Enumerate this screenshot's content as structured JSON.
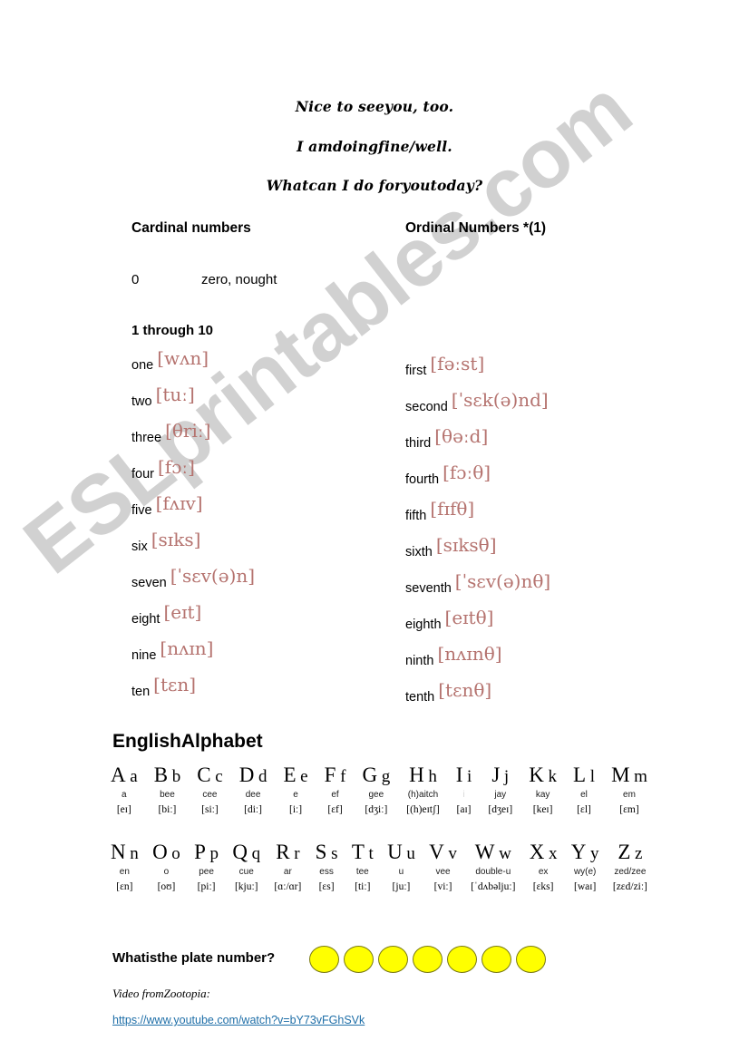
{
  "watermark": {
    "text": "ESLprintables.com"
  },
  "greetings": [
    "Nice to seeyou, too.",
    "I amdoingfine/well.",
    "Whatcan I do foryoutoday?"
  ],
  "columns": {
    "cardinal_heading": "Cardinal numbers",
    "ordinal_heading": "Ordinal Numbers *(1)"
  },
  "zero": {
    "digit": "0",
    "words": "zero, nought"
  },
  "range_label": "1 through 10",
  "cardinals": [
    {
      "word": "one",
      "ipa": "[wʌn]"
    },
    {
      "word": "two",
      "ipa": "[tuː]"
    },
    {
      "word": "three",
      "ipa": "[θriː]"
    },
    {
      "word": "four",
      "ipa": "[fɔː]"
    },
    {
      "word": "five",
      "ipa": "[fʌɪv]"
    },
    {
      "word": "six",
      "ipa": "[sɪks]"
    },
    {
      "word": "seven",
      "ipa": "[ˈsɛv(ə)n]"
    },
    {
      "word": "eight",
      "ipa": "[eɪt]"
    },
    {
      "word": "nine",
      "ipa": "[nʌɪn]"
    },
    {
      "word": "ten",
      "ipa": "[tɛn]"
    }
  ],
  "ordinals": [
    {
      "word": "first",
      "ipa": "[fəːst]"
    },
    {
      "word": "second",
      "ipa": "[ˈsɛk(ə)nd]"
    },
    {
      "word": "third",
      "ipa": "[θəːd]"
    },
    {
      "word": "fourth",
      "ipa": "[fɔːθ]"
    },
    {
      "word": "fifth",
      "ipa": "[fɪfθ]"
    },
    {
      "word": "sixth",
      "ipa": "[sɪksθ]"
    },
    {
      "word": "seventh",
      "ipa": "[ˈsɛv(ə)nθ]"
    },
    {
      "word": "eighth",
      "ipa": "[eɪtθ]"
    },
    {
      "word": "ninth",
      "ipa": "[nʌɪnθ]"
    },
    {
      "word": "tenth",
      "ipa": "[tɛnθ]"
    }
  ],
  "alphabet": {
    "title": "EnglishAlphabet",
    "row1": [
      {
        "upper": "A",
        "lower": "a",
        "name": "a",
        "ipa": "[eɪ]"
      },
      {
        "upper": "B",
        "lower": "b",
        "name": "bee",
        "ipa": "[biː]"
      },
      {
        "upper": "C",
        "lower": "c",
        "name": "cee",
        "ipa": "[siː]"
      },
      {
        "upper": "D",
        "lower": "d",
        "name": "dee",
        "ipa": "[diː]"
      },
      {
        "upper": "E",
        "lower": "e",
        "name": "e",
        "ipa": "[iː]"
      },
      {
        "upper": "F",
        "lower": "f",
        "name": "ef",
        "ipa": "[ɛf]"
      },
      {
        "upper": "G",
        "lower": "g",
        "name": "gee",
        "ipa": "[dʒiː]"
      },
      {
        "upper": "H",
        "lower": "h",
        "name": "(h)aitch",
        "ipa": "[(h)eɪtʃ]"
      },
      {
        "upper": "I",
        "lower": "i",
        "name": "i",
        "ipa": "[aɪ]",
        "faint": true
      },
      {
        "upper": "J",
        "lower": "j",
        "name": "jay",
        "ipa": "[dʒeɪ]"
      },
      {
        "upper": "K",
        "lower": "k",
        "name": "kay",
        "ipa": "[keɪ]"
      },
      {
        "upper": "L",
        "lower": "l",
        "name": "el",
        "ipa": "[ɛl]"
      },
      {
        "upper": "M",
        "lower": "m",
        "name": "em",
        "ipa": "[ɛm]"
      }
    ],
    "row2": [
      {
        "upper": "N",
        "lower": "n",
        "name": "en",
        "ipa": "[ɛn]"
      },
      {
        "upper": "O",
        "lower": "o",
        "name": "o",
        "ipa": "[oʊ]"
      },
      {
        "upper": "P",
        "lower": "p",
        "name": "pee",
        "ipa": "[piː]"
      },
      {
        "upper": "Q",
        "lower": "q",
        "name": "cue",
        "ipa": "[kjuː]"
      },
      {
        "upper": "R",
        "lower": "r",
        "name": "ar",
        "ipa": "[ɑː/ɑr]"
      },
      {
        "upper": "S",
        "lower": "s",
        "name": "ess",
        "ipa": "[ɛs]"
      },
      {
        "upper": "T",
        "lower": "t",
        "name": "tee",
        "ipa": "[tiː]"
      },
      {
        "upper": "U",
        "lower": "u",
        "name": "u",
        "ipa": "[juː]"
      },
      {
        "upper": "V",
        "lower": "v",
        "name": "vee",
        "ipa": "[viː]"
      },
      {
        "upper": "W",
        "lower": "w",
        "name": "double-u",
        "ipa": "[ˈdʌbəljuː]"
      },
      {
        "upper": "X",
        "lower": "x",
        "name": "ex",
        "ipa": "[ɛks]"
      },
      {
        "upper": "Y",
        "lower": "y",
        "name": "wy(e)",
        "ipa": "[waɪ]"
      },
      {
        "upper": "Z",
        "lower": "z",
        "name": "zed/zee",
        "ipa": "[zɛd/ziː]"
      }
    ]
  },
  "plate": {
    "question": "Whatisthe plate number?",
    "circle_count": 7,
    "circle_color": "#ffff00"
  },
  "video": {
    "label": "Video fromZootopia:",
    "url": "https://www.youtube.com/watch?v=bY73vFGhSVk"
  }
}
